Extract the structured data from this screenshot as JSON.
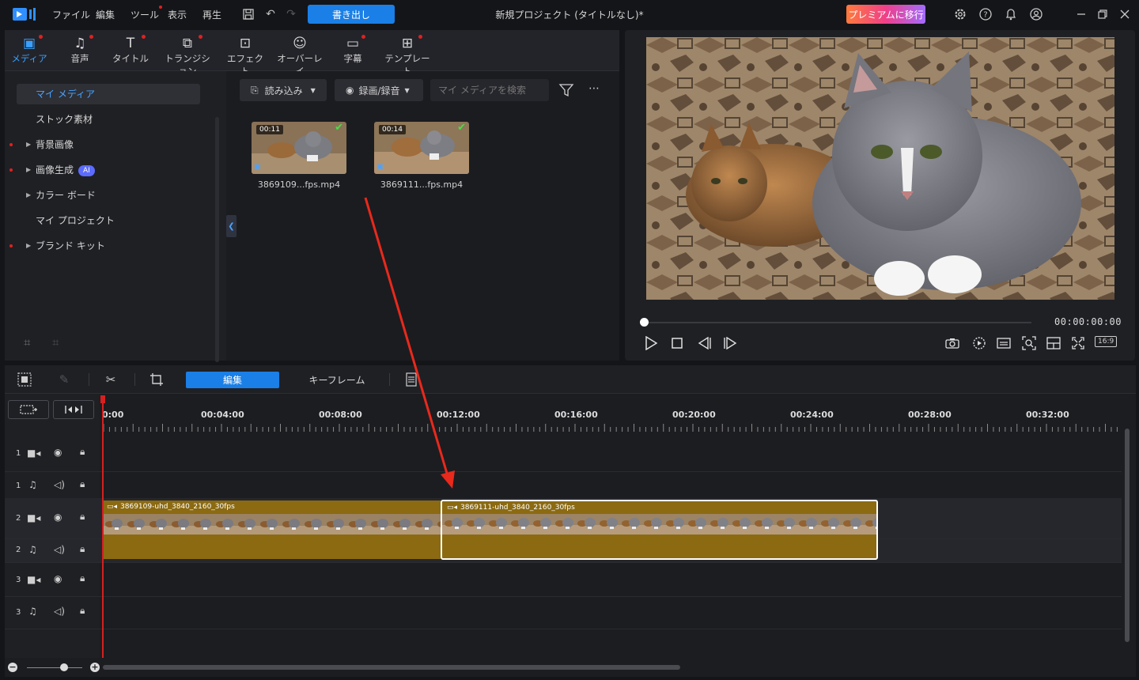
{
  "titlebar": {
    "menu": [
      "ファイル",
      "編集",
      "ツール",
      "表示",
      "再生"
    ],
    "export_label": "書き出し",
    "project_title": "新規プロジェクト (タイトルなし)*",
    "premium_label": "プレミアムに移行"
  },
  "library": {
    "tabs": [
      "メディア",
      "音声",
      "タイトル",
      "トランジション",
      "エフェクト",
      "オーバーレイ",
      "字幕",
      "テンプレート"
    ],
    "tree": {
      "my_media": "マイ メディア",
      "stock": "ストック素材",
      "background": "背景画像",
      "image_gen": "画像生成",
      "ai_badge": "AI",
      "color_board": "カラー ボード",
      "my_project": "マイ プロジェクト",
      "brand_kit": "ブランド キット"
    },
    "import_label": "読み込み",
    "record_label": "録画/録音",
    "search_placeholder": "マイ メディアを検索",
    "media": [
      {
        "name": "3869109...fps.mp4",
        "duration": "00:11"
      },
      {
        "name": "3869111...fps.mp4",
        "duration": "00:14"
      }
    ]
  },
  "preview": {
    "timecode": "00:00:00:00",
    "aspect": "16:9",
    "progress": 0
  },
  "timeline": {
    "edit_tab": "編集",
    "keyframe_tab": "キーフレーム",
    "ruler_labels": [
      "0:00",
      "00:04:00",
      "00:08:00",
      "00:12:00",
      "00:16:00",
      "00:20:00",
      "00:24:00",
      "00:28:00",
      "00:32:00"
    ],
    "tracks": [
      "1",
      "1",
      "2",
      "2",
      "3",
      "3"
    ],
    "clips": [
      {
        "title": "3869109-uhd_3840_2160_30fps"
      },
      {
        "title": "3869111-uhd_3840_2160_30fps"
      }
    ]
  },
  "colors": {
    "accent": "#1a7fe6",
    "clip": "#8b6a12",
    "playhead": "#d62020",
    "annotation": "#e8291c"
  }
}
